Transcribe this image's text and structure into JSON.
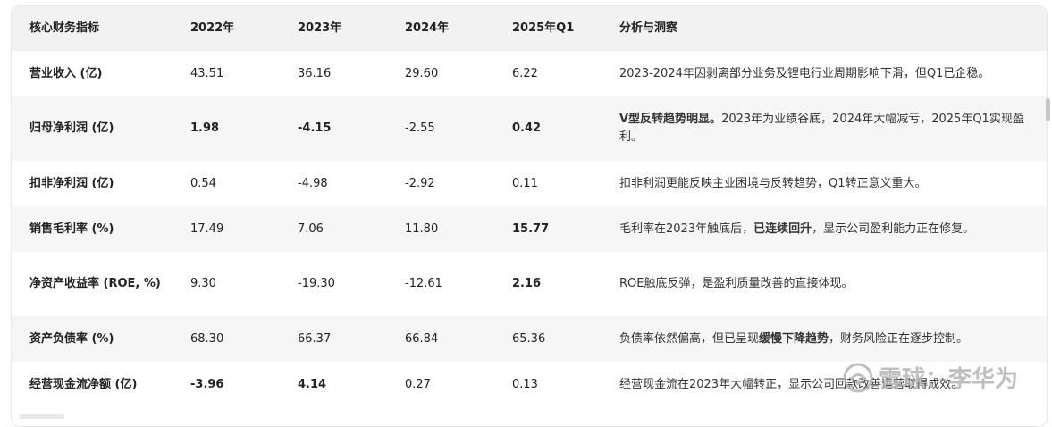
{
  "header": {
    "metric": "核心财务指标",
    "y2022": "2022年",
    "y2023": "2023年",
    "y2024": "2024年",
    "y2025q1": "2025年Q1",
    "analysis": "分析与洞察"
  },
  "rows": [
    {
      "label": "营业收入 (亿)",
      "v2022": "43.51",
      "v2023": "36.16",
      "v2024": "29.60",
      "v2025q1": "6.22",
      "analysis_strong": "",
      "analysis": "2023-2024年因剥离部分业务及锂电行业周期影响下滑，但Q1已企稳。"
    },
    {
      "label": "归母净利润 (亿)",
      "v2022": "1.98",
      "v2023": "-4.15",
      "v2024": "-2.55",
      "v2025q1": "0.42",
      "analysis_strong": "V型反转趋势明显。",
      "analysis": "2023年为业绩谷底，2024年大幅减亏，2025年Q1实现盈利。"
    },
    {
      "label": "扣非净利润 (亿)",
      "v2022": "0.54",
      "v2023": "-4.98",
      "v2024": "-2.92",
      "v2025q1": "0.11",
      "analysis_strong": "",
      "analysis": "扣非利润更能反映主业困境与反转趋势，Q1转正意义重大。"
    },
    {
      "label": "销售毛利率 (%)",
      "v2022": "17.49",
      "v2023": "7.06",
      "v2024": "11.80",
      "v2025q1": "15.77",
      "analysis_pre": "毛利率在2023年触底后，",
      "analysis_strong": "已连续回升",
      "analysis": "，显示公司盈利能力正在修复。"
    },
    {
      "label": "净资产收益率 (ROE, %)",
      "v2022": "9.30",
      "v2023": "-19.30",
      "v2024": "-12.61",
      "v2025q1": "2.16",
      "analysis_strong": "",
      "analysis": "ROE触底反弹，是盈利质量改善的直接体现。"
    },
    {
      "label": "资产负债率 (%)",
      "v2022": "68.30",
      "v2023": "66.37",
      "v2024": "66.84",
      "v2025q1": "65.36",
      "analysis_pre": "负债率依然偏高，但已呈现",
      "analysis_strong": "缓慢下降趋势",
      "analysis": "，财务风险正在逐步控制。"
    },
    {
      "label": "经营现金流净额 (亿)",
      "v2022": "-3.96",
      "v2023": "4.14",
      "v2024": "0.27",
      "v2025q1": "0.13",
      "analysis_strong": "",
      "analysis": "经营现金流在2023年大幅转正，显示公司回款改善运营取得成效。"
    }
  ],
  "watermark": {
    "text": "雪球：李华为"
  }
}
